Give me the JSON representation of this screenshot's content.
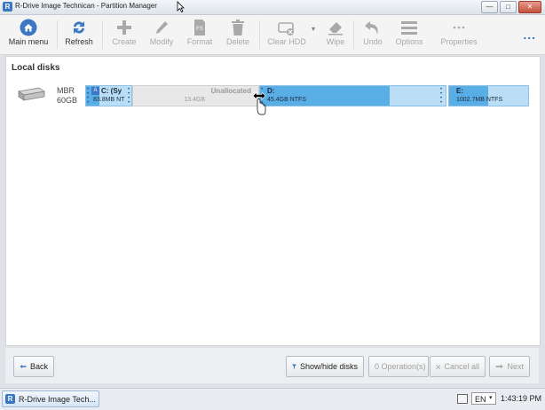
{
  "window": {
    "title": "R-Drive Image Technican - Partition Manager",
    "app_icon_letter": "R",
    "buttons": [
      "minimize",
      "maximize",
      "close"
    ]
  },
  "toolbar": {
    "items": [
      {
        "label": "Main menu",
        "icon": "home-icon",
        "enabled": true
      },
      {
        "label": "Refresh",
        "icon": "refresh-icon",
        "enabled": true
      },
      {
        "label": "Create",
        "icon": "plus-icon",
        "enabled": false
      },
      {
        "label": "Modify",
        "icon": "pencil-icon",
        "enabled": false
      },
      {
        "label": "Format",
        "icon": "format-fs-icon",
        "enabled": false
      },
      {
        "label": "Delete",
        "icon": "trash-icon",
        "enabled": false
      },
      {
        "label": "Clear HDD",
        "icon": "clear-hdd-icon",
        "enabled": false
      },
      {
        "label": "Wipe",
        "icon": "eraser-icon",
        "enabled": false
      },
      {
        "label": "Undo",
        "icon": "undo-icon",
        "enabled": false
      },
      {
        "label": "Options",
        "icon": "hamburger-icon",
        "enabled": false
      },
      {
        "label": "Properties",
        "icon": "ellipsis-icon",
        "enabled": false
      }
    ],
    "more": "...",
    "accent": "#3b78c3"
  },
  "content": {
    "section_title": "Local disks",
    "disk": {
      "type": "MBR",
      "size": "60GB",
      "partitions": [
        {
          "name": "C: (Sy",
          "size": "83.8MB NT",
          "kind": "ntfs",
          "flag": "A"
        },
        {
          "name": "Unallocated",
          "size": "13.4GB",
          "kind": "unallocated"
        },
        {
          "name": "D:",
          "size": "45.4GB NTFS",
          "kind": "ntfs"
        },
        {
          "name": "E:",
          "size": "1002.7MB NTFS",
          "kind": "ntfs"
        }
      ]
    }
  },
  "bottom": {
    "back": "Back",
    "show_hide": "Show/hide disks",
    "operations": "0 Operation(s)",
    "cancel_all": "Cancel all",
    "next": "Next"
  },
  "taskbar": {
    "task_label": "R-Drive Image Tech...",
    "language": "EN",
    "clock": "1:43:19 PM"
  },
  "colors": {
    "partition_fill": "#5aaee6",
    "partition_free": "#b9def6",
    "unallocated": "#e8e8e8"
  }
}
